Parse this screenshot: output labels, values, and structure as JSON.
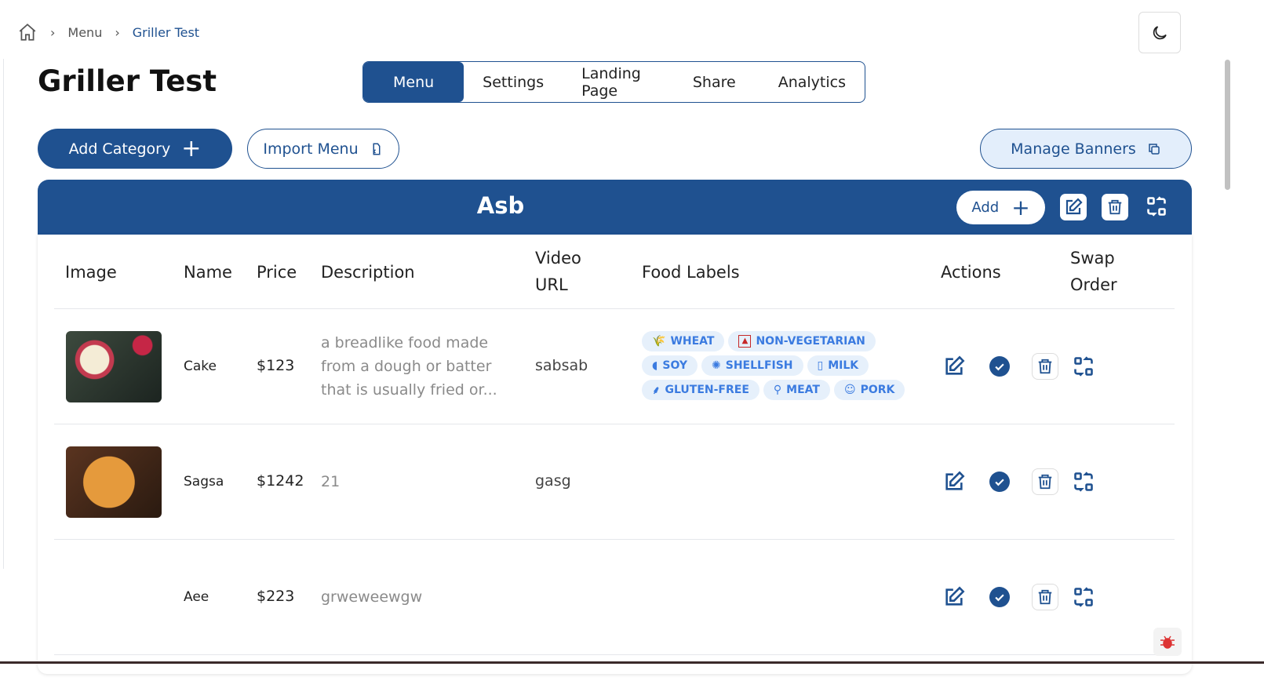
{
  "breadcrumb": {
    "items": [
      "Menu",
      "Griller Test"
    ]
  },
  "page_title": "Griller Test",
  "tabs": [
    {
      "label": "Menu",
      "active": true
    },
    {
      "label": "Settings"
    },
    {
      "label": "Landing Page"
    },
    {
      "label": "Share"
    },
    {
      "label": "Analytics"
    }
  ],
  "toolbar": {
    "add_category": "Add Category",
    "import_menu": "Import Menu",
    "manage_banners": "Manage Banners"
  },
  "category": {
    "title": "Asb",
    "add_label": "Add"
  },
  "table": {
    "headers": {
      "image": "Image",
      "name": "Name",
      "price": "Price",
      "description": "Description",
      "video_1": "Video",
      "video_2": "URL",
      "labels": "Food Labels",
      "actions": "Actions",
      "swap_1": "Swap",
      "swap_2": "Order"
    },
    "rows": [
      {
        "name": "Cake",
        "price": "$123",
        "description": "a breadlike food made from a dough or batter that is usually fried or...",
        "video": "sabsab",
        "labels": [
          "WHEAT",
          "NON-VEGETARIAN",
          "SOY",
          "SHELLFISH",
          "MILK",
          "GLUTEN-FREE",
          "MEAT",
          "PORK"
        ]
      },
      {
        "name": "Sagsa",
        "price": "$1242",
        "description": "21",
        "video": "gasg",
        "labels": []
      },
      {
        "name": "Aee",
        "price": "$223",
        "description": "grweweewgw",
        "video": "",
        "labels": []
      }
    ]
  },
  "colors": {
    "primary": "#1f5190",
    "label_bg": "#e6f0fb",
    "label_text": "#3b7be0"
  }
}
